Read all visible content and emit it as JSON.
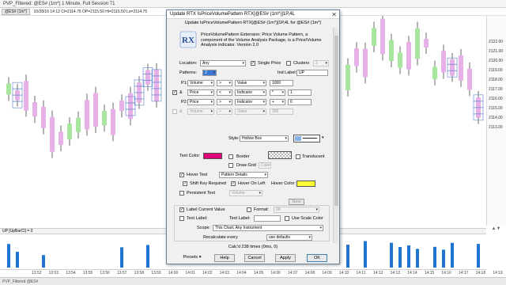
{
  "chart": {
    "title": "PVP_Filtered: @ES# (1m*) 1 Minute, Full Session 71",
    "info_symbol": "@ES# (1m*)",
    "info_text": "10/28/16 14:12 Cl=2114.75 OP=2115.50 Hi=2115.50 Lo=2114.75",
    "indicator_label": "UP [UpBarCl] = 0",
    "status_text": "PVP_Filtered  @ES#",
    "price_labels": [
      "2122.00",
      "2121.00",
      "2120.00",
      "2119.00",
      "2118.00",
      "2117.00",
      "2116.00",
      "2115.00",
      "2114.00",
      "2113.00"
    ],
    "time_labels": [
      "13:52",
      "13:53",
      "13:54",
      "13:55",
      "13:56",
      "13:57",
      "13:58",
      "13:59",
      "14:00",
      "14:01",
      "14:02",
      "14:03",
      "14:04",
      "14:05",
      "14:06",
      "14:07",
      "14:08",
      "14:09",
      "14:10",
      "14:11",
      "14:12",
      "14:13",
      "14:14",
      "14:15",
      "14:16",
      "14:17",
      "14:18",
      "14:19"
    ],
    "colors": {
      "up": "#a8e6a0",
      "down": "#e8b0e8",
      "box": "#6f8fd0",
      "wick": "#444444",
      "volume": "#1f75d0"
    }
  },
  "dialog": {
    "title": "Update RTX IsPriceVolumePattern RTX[@ES# (1m*)]1P,4L",
    "close_glyph": "✕",
    "subtitle": "Update IsPriceVolumePattern RTX[@ES# (1m*)]1P,4L for @ES# (1m*)",
    "logo_text": "RX",
    "description": "PriceVolumePattern Extension: Price Volume Pattern, a component of the Volume Analysis Package, is a Price/Volume Analysis indicator. Version 2.0",
    "location": {
      "label": "Location:",
      "value": "Any"
    },
    "single_price": {
      "label": "Single Price",
      "checked": true
    },
    "clusters": {
      "label": "Clusters",
      "value": "2",
      "checked": false
    },
    "patterns": {
      "label": "Patterns:",
      "value": "2"
    },
    "ind_label": {
      "label": "Ind Label:",
      "value": "UP"
    },
    "rows": [
      {
        "prefix": "P1:",
        "field": "Volume",
        "op": ">",
        "target": "Value",
        "op2": "",
        "value": "1000",
        "enabled": true
      },
      {
        "prefix": "&",
        "field": "Price",
        "op": "<",
        "target": "Indicator",
        "op2": "*",
        "value": "1",
        "enabled": true
      },
      {
        "prefix": "P2:",
        "field": "Price",
        "op": ">",
        "target": "Indicator",
        "op2": "+",
        "value": "0",
        "enabled": true
      },
      {
        "prefix": "&",
        "field": "Volume",
        "op": ">",
        "target": "Value",
        "op2": "",
        "value": "300",
        "enabled": false
      }
    ],
    "style": {
      "label": "Style:",
      "value": "Hollow Box"
    },
    "text_color": {
      "label": "Text Color:",
      "color": "#e0007a"
    },
    "border": {
      "label": "Border",
      "checked": false
    },
    "translucent": {
      "label": "Translucent",
      "checked": false
    },
    "draw_grid": {
      "label": "Draw Grid",
      "color_label": "Color",
      "checked": false
    },
    "hover_text": {
      "label": "Hover Text",
      "checked": true,
      "value": "Pattern Details"
    },
    "shift_key": {
      "label": "Shift Key Required",
      "checked": true
    },
    "hover_on_left": {
      "label": "Hover On Left",
      "checked": true
    },
    "hover_color": {
      "label": "Hover Color:",
      "color": "#ffff33"
    },
    "persistent_text": {
      "label": "Persistent Text",
      "checked": false,
      "value": "Volume",
      "new_label": "New"
    },
    "label_current_value": {
      "label": "Label Current Value",
      "checked": true
    },
    "format": {
      "label": "Format:",
      "value": "99",
      "checked": false
    },
    "text_label_check": {
      "label": "Text Label:",
      "checked": false
    },
    "text_label_field": {
      "label": "Text Label:",
      "value": ""
    },
    "use_scale_color": {
      "label": "Use Scale Color",
      "checked": false
    },
    "scope": {
      "label": "Scope:",
      "value": "This Chart, Any Instrument"
    },
    "recalculate": {
      "label": "Recalculate every",
      "value": "use defaults"
    },
    "calc_info": "Calc'd 238 times (0ms, 0)",
    "buttons": {
      "presets": "Presets",
      "help": "Help",
      "cancel": "Cancel",
      "apply": "Apply",
      "ok": "OK"
    }
  }
}
